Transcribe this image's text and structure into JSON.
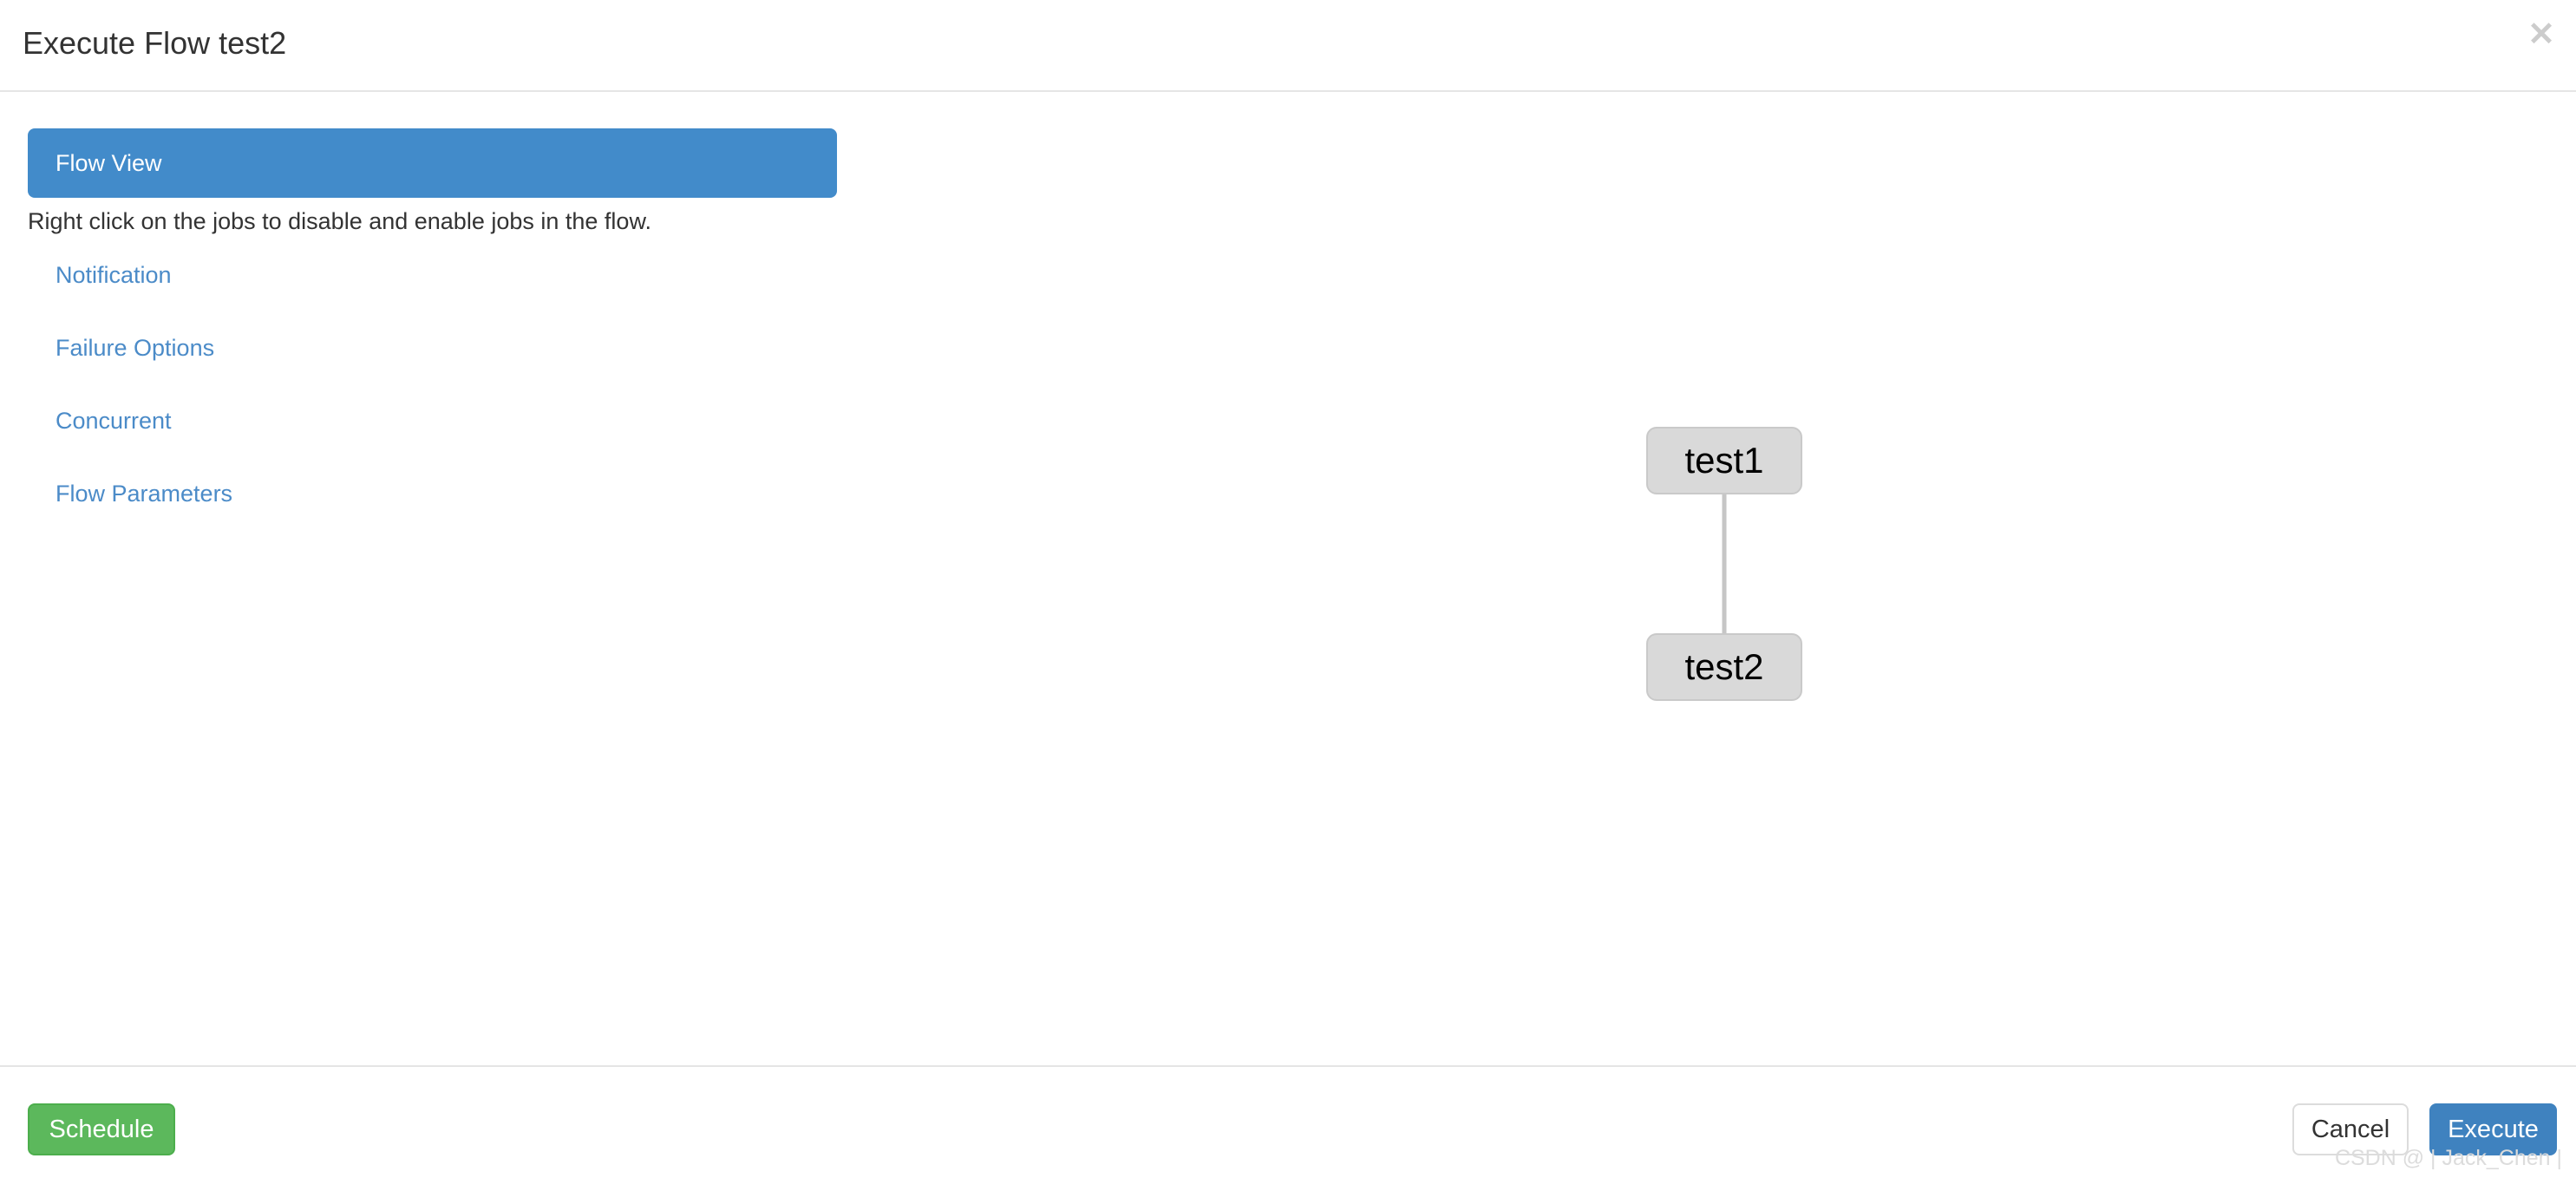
{
  "header": {
    "title": "Execute Flow test2",
    "close_icon": "close-icon",
    "close_glyph": "✕"
  },
  "side_panel": {
    "active_tab": "Flow View",
    "hint": "Right click on the jobs to disable and enable jobs in the flow.",
    "links": [
      {
        "label": "Notification"
      },
      {
        "label": "Failure Options"
      },
      {
        "label": "Concurrent"
      },
      {
        "label": "Flow Parameters"
      }
    ]
  },
  "flow_graph": {
    "nodes": [
      {
        "id": "test1",
        "label": "test1"
      },
      {
        "id": "test2",
        "label": "test2"
      }
    ],
    "edges": [
      {
        "from": "test1",
        "to": "test2"
      }
    ],
    "node_fill": "#d9d9d9",
    "node_border": "#c9c9c9",
    "edge_color": "#c6c6c6"
  },
  "footer": {
    "schedule_label": "Schedule",
    "cancel_label": "Cancel",
    "execute_label": "Execute"
  },
  "watermark": "CSDN @ | Jack_Chen |",
  "colors": {
    "primary_blue": "#428bca",
    "execute_blue": "#3f82bf",
    "link_blue": "#4b8bc8",
    "schedule_green": "#5cb85c",
    "divider": "#e5e5e5"
  }
}
